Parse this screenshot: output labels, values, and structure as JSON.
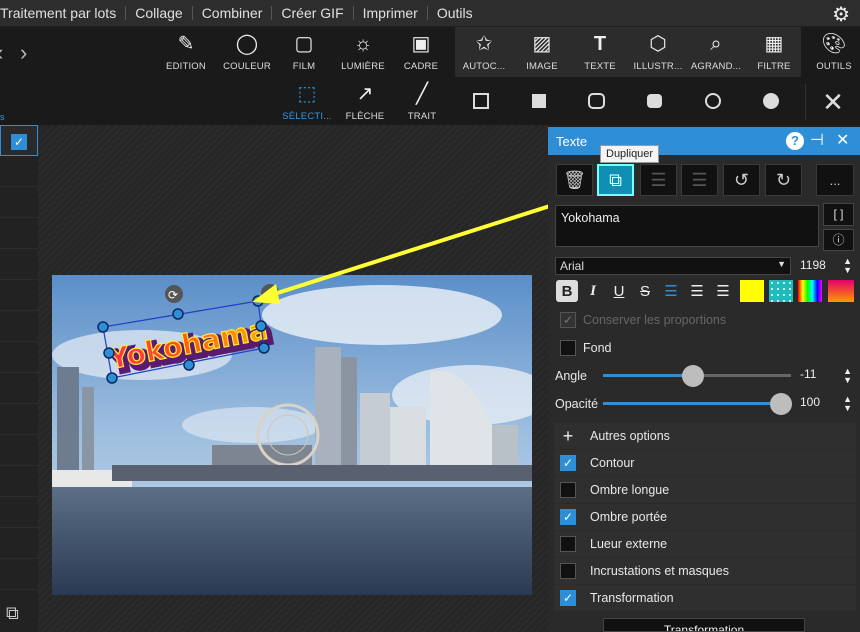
{
  "menu": [
    "Traitement par lots",
    "Collage",
    "Combiner",
    "Créer GIF",
    "Imprimer",
    "Outils"
  ],
  "toolbar": {
    "main": [
      {
        "label": "EDITION",
        "icon": "edit-icon"
      },
      {
        "label": "COULEUR",
        "icon": "circle-icon"
      },
      {
        "label": "FILM",
        "icon": "film-icon"
      },
      {
        "label": "LUMIÈRE",
        "icon": "sun-icon"
      },
      {
        "label": "CADRE",
        "icon": "frame-icon"
      },
      {
        "label": "AUTOC...",
        "icon": "star-frame-icon"
      },
      {
        "label": "IMAGE",
        "icon": "image-icon"
      },
      {
        "label": "TEXTE",
        "icon": "text-icon"
      },
      {
        "label": "ILLUSTR...",
        "icon": "illustration-icon"
      },
      {
        "label": "AGRAND...",
        "icon": "magnify-icon"
      },
      {
        "label": "FILTRE",
        "icon": "filter-icon"
      },
      {
        "label": "OUTILS",
        "icon": "palette-icon"
      }
    ],
    "secondary": [
      {
        "label": "SÉLECTI...",
        "icon": "selection-icon"
      },
      {
        "label": "FLÈCHE",
        "icon": "arrow-icon"
      },
      {
        "label": "TRAIT",
        "icon": "line-icon"
      }
    ]
  },
  "canvas": {
    "overlay_text": "Yokohama"
  },
  "panel": {
    "title": "Texte",
    "tooltip": "Dupliquer",
    "more_label": "...",
    "text_value": "Yokohama",
    "bracket_label": "[ ]",
    "font": "Arial",
    "font_size": "1198",
    "keep_proportions": "Conserver les proportions",
    "background": "Fond",
    "angle_label": "Angle",
    "angle_value": "-11",
    "angle_fraction": 0.48,
    "opacity_label": "Opacité",
    "opacity_value": "100",
    "opacity_fraction": 1.0,
    "options": [
      {
        "icon": "+",
        "label": "Autres options"
      },
      {
        "label": "Contour",
        "checked": true
      },
      {
        "label": "Ombre longue",
        "checked": false
      },
      {
        "label": "Ombre portée",
        "checked": true
      },
      {
        "label": "Lueur externe",
        "checked": false
      },
      {
        "label": "Incrustations et masques",
        "checked": false
      },
      {
        "label": "Transformation",
        "checked": true
      }
    ],
    "bottom_button": "Transformation"
  },
  "colors": {
    "accent": "#2e8fd6",
    "text_fill": "#ffff00",
    "arrow": "#ffff33"
  }
}
